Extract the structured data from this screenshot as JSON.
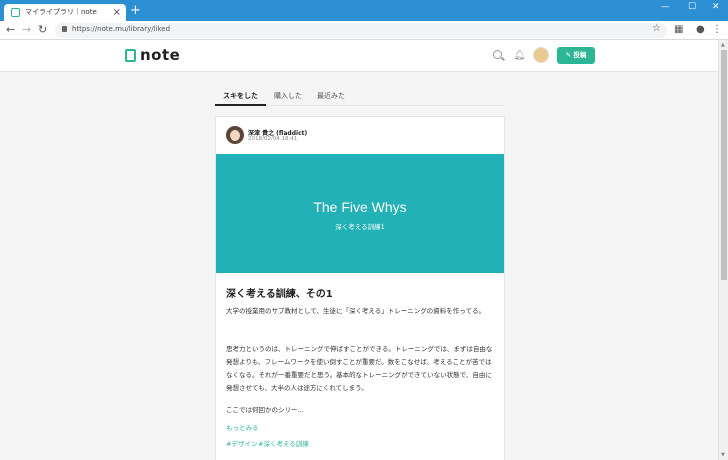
{
  "browser": {
    "tab_title": "マイライブラリ｜note",
    "tab_close": "×",
    "new_tab": "+",
    "url": "https://note.mu/library/liked",
    "window_controls": [
      "—",
      "☐",
      "✕"
    ]
  },
  "header": {
    "logo": "note",
    "post_button": "✎ 投稿"
  },
  "library_tabs": [
    "スキをした",
    "購入した",
    "最近みた"
  ],
  "article": {
    "author": "深津 貴之 (fladdict)",
    "date": "2018/02/04 18:41",
    "hero_title": "The Five Whys",
    "hero_subtitle": "深く考える訓練1",
    "title": "深く考える訓練、その1",
    "paragraph1": "大学の授業用のサブ教材として、生徒に「深く考える」トレーニングの資料を作ってる。",
    "paragraph2": "思考力というのは、トレーニングで伸ばすことができる。トレーニングでは、まずは自由な発想よりも、フレームワークを使い倒すことが重要だ。数をこなせば、考えることが苦ではなくなる。それが一番重要だと思う。基本的なトレーニングができていない状態で、自由に発想させても、大半の人は途方にくれてしまう。",
    "paragraph3": "ここでは何回かのシリー…",
    "more": "もっとみる",
    "tags": [
      "#デザイン",
      "#深く考える訓練"
    ]
  },
  "colors": {
    "accent": "#2cb696",
    "hero_bg": "#22b1b6",
    "chrome_bar": "#2d8fd3"
  }
}
